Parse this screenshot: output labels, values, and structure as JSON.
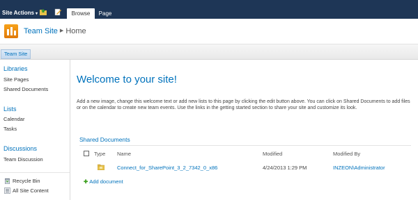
{
  "ribbon": {
    "site_actions": "Site Actions",
    "tabs": [
      "Browse",
      "Page"
    ]
  },
  "header": {
    "site_name": "Team Site",
    "page_name": "Home"
  },
  "topnav": {
    "items": [
      "Team Site"
    ]
  },
  "quicklaunch": {
    "libraries_heading": "Libraries",
    "libraries": [
      "Site Pages",
      "Shared Documents"
    ],
    "lists_heading": "Lists",
    "lists": [
      "Calendar",
      "Tasks"
    ],
    "discussions_heading": "Discussions",
    "discussions": [
      "Team Discussion"
    ],
    "recycle_bin": "Recycle Bin",
    "all_site_content": "All Site Content"
  },
  "main": {
    "welcome_title": "Welcome to your site!",
    "intro_text": "Add a new image, change this welcome text or add new lists to this page by clicking the edit button above. You can click on Shared Documents to add files or on the calendar to create new team events. Use the links in the getting started section to share your site and customize its look.",
    "webpart_title": "Shared Documents",
    "columns": {
      "type": "Type",
      "name": "Name",
      "modified": "Modified",
      "modified_by": "Modified By"
    },
    "rows": [
      {
        "name": "Connect_for_SharePoint_3_2_7342_0_x86",
        "modified": "4/24/2013 1:29 PM",
        "modified_by": "INZEON\\Administrator"
      }
    ],
    "add_document": "Add document"
  },
  "icons": {
    "navigate_up": "folder-nav-icon",
    "edit_page": "edit-page-icon",
    "logo": "team-site-logo-icon",
    "folder": "folder-icon",
    "recycle": "recycle-bin-icon",
    "all_content": "all-site-content-icon"
  },
  "colors": {
    "ribbon": "#1e3656",
    "link": "#0072bc",
    "logo": "#f7a21b"
  }
}
